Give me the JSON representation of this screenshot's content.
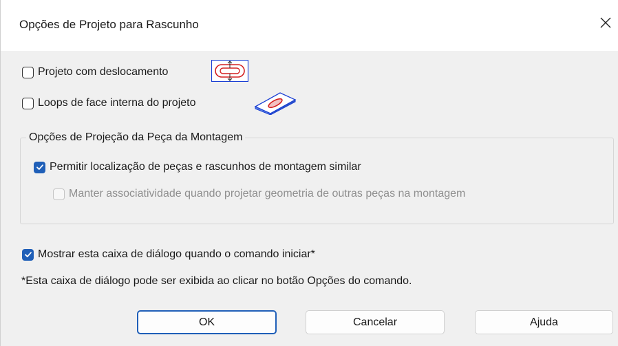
{
  "window": {
    "title": "Opções de Projeto para Rascunho"
  },
  "options": {
    "offset_project": {
      "label": "Projeto com deslocamento",
      "checked": false
    },
    "inner_loops": {
      "label": "Loops de face interna do projeto",
      "checked": false
    }
  },
  "assembly_group": {
    "legend": "Opções de Projeção da Peça da Montagem",
    "allow_location": {
      "label": "Permitir localização de peças e rascunhos de montagem similar",
      "checked": true
    },
    "keep_associativity": {
      "label": "Manter associatividade quando projetar geometria de outras peças na montagem",
      "checked": false,
      "disabled": true
    }
  },
  "show_dialog": {
    "label": "Mostrar esta caixa de diálogo quando o comando iniciar*",
    "checked": true
  },
  "note": "*Esta caixa de diálogo pode ser exibida ao clicar no botão Opções do comando.",
  "buttons": {
    "ok": "OK",
    "cancel": "Cancelar",
    "help": "Ajuda"
  },
  "icons": {
    "close": "close-icon",
    "offset": "offset-project-icon",
    "inner_loops": "face-loops-icon",
    "check": "checkmark-icon"
  },
  "colors": {
    "accent": "#1f5fb8",
    "icon_red": "#d42020",
    "icon_blue": "#1a3fd4"
  }
}
